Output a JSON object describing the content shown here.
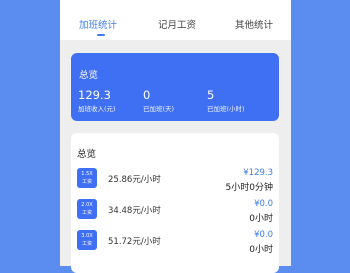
{
  "tabs": [
    {
      "label": "加班统计",
      "active": true
    },
    {
      "label": "记月工资",
      "active": false
    },
    {
      "label": "其他统计",
      "active": false
    }
  ],
  "summary_card": {
    "title": "总览",
    "stats": [
      {
        "value": "129.3",
        "label": "加班收入(元)"
      },
      {
        "value": "0",
        "label": "已加班(天)"
      },
      {
        "value": "5",
        "label": "已加班(小时)"
      }
    ]
  },
  "detail_card": {
    "title": "总览",
    "rows": [
      {
        "badge_top": "1.5X",
        "badge_bottom": "工资",
        "rate": "25.86元/小时",
        "amount": "¥129.3",
        "duration": "5小时0分钟"
      },
      {
        "badge_top": "2.0X",
        "badge_bottom": "工资",
        "rate": "34.48元/小时",
        "amount": "¥0.0",
        "duration": "0小时"
      },
      {
        "badge_top": "3.0X",
        "badge_bottom": "工资",
        "rate": "51.72元/小时",
        "amount": "¥0.0",
        "duration": "0小时"
      }
    ]
  },
  "colors": {
    "accent": "#3f7cf0",
    "card_blue": "#3f6ff2",
    "outer_bg": "#5b8df0"
  }
}
